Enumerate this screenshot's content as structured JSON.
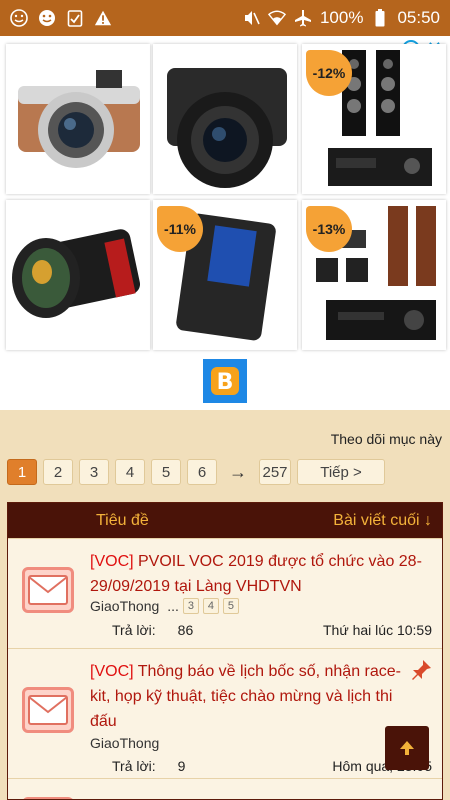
{
  "status_bar": {
    "left_icons": [
      "smiley-face-icon",
      "emoji-icon",
      "clipboard-check-icon",
      "warning-icon"
    ],
    "battery": "100%",
    "time": "05:50",
    "right_icons": [
      "mute-icon",
      "wifi-icon",
      "airplane-icon",
      "battery-icon"
    ]
  },
  "ad": {
    "info_icon": "i",
    "close_icon": "✕",
    "tiles": [
      {
        "product": "camera-silver-brown",
        "discount": ""
      },
      {
        "product": "camera-black-sony",
        "discount": ""
      },
      {
        "product": "speakers-yamaha",
        "discount": "-12%"
      },
      {
        "product": "cine-lens",
        "discount": ""
      },
      {
        "product": "battery-pack",
        "discount": "-11%"
      },
      {
        "product": "home-theater",
        "discount": "-13%"
      }
    ],
    "logo_letter": "B"
  },
  "follow_link": "Theo dõi mục này",
  "pagination": {
    "pages": [
      "1",
      "2",
      "3",
      "4",
      "5",
      "6"
    ],
    "active": "1",
    "arrow": "→",
    "last": "257",
    "next": "Tiếp >"
  },
  "table": {
    "col_title": "Tiêu đề",
    "col_last": "Bài viết cuối ↓",
    "threads": [
      {
        "tag": "[VOC]",
        "title": " PVOIL VOC 2019 được tổ chức vào 28-29/09/2019 tại Làng VHDTVN",
        "author": "GiaoThong",
        "ellipsis": "...",
        "pages": [
          "3",
          "4",
          "5"
        ],
        "replies_label": "Trả lời:",
        "replies": "86",
        "last_post": "Thứ hai lúc 10:59",
        "pinned": false
      },
      {
        "tag": "[VOC]",
        "title": " Thông báo về lịch bốc số, nhận race-kit, họp kỹ thuật, tiệc chào mừng và lịch thi đấu",
        "author": "GiaoThong",
        "replies_label": "Trả lời:",
        "replies": "9",
        "last_post": "Hôm qua, 23:05",
        "pinned": true
      }
    ]
  },
  "back_to_top": "↑"
}
